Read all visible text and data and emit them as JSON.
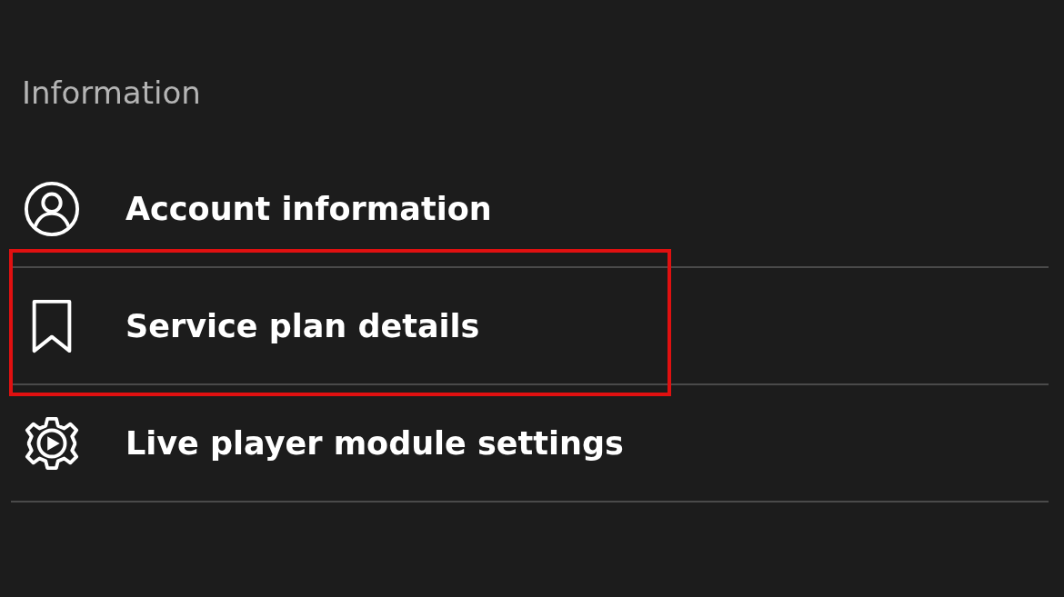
{
  "section": {
    "title": "Information"
  },
  "items": [
    {
      "kind": "account",
      "label": "Account information",
      "highlighted": false
    },
    {
      "kind": "plan",
      "label": "Service plan details",
      "highlighted": true
    },
    {
      "kind": "player",
      "label": "Live player module settings",
      "highlighted": false
    }
  ]
}
